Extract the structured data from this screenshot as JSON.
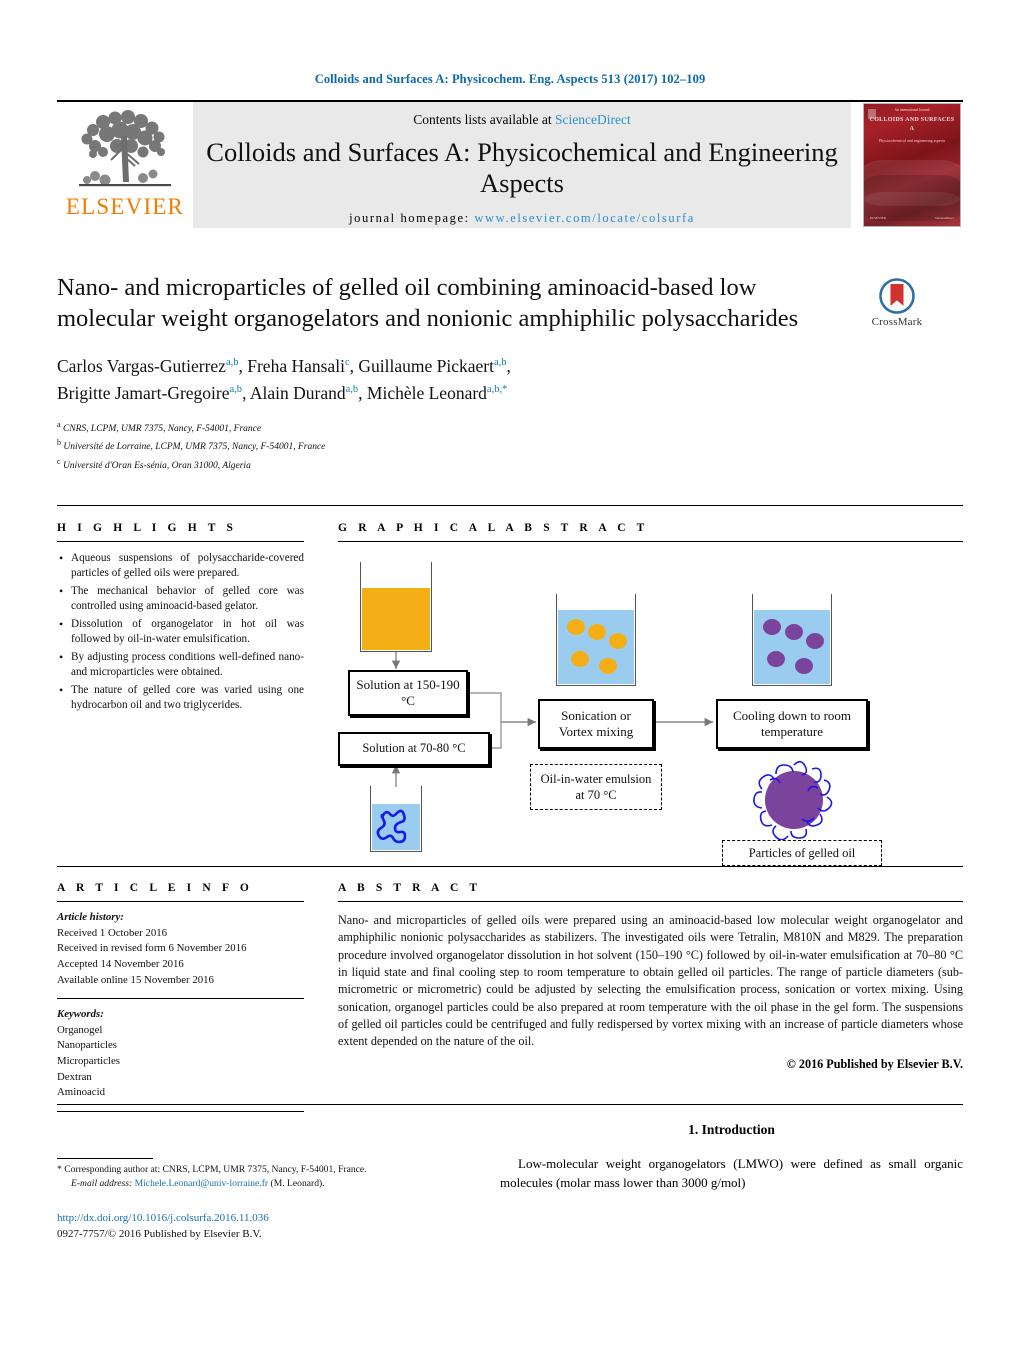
{
  "running_head": "Colloids and Surfaces A: Physicochem. Eng. Aspects 513 (2017) 102–109",
  "masthead": {
    "publisher_word": "ELSEVIER",
    "contents_prefix": "Contents lists available at ",
    "contents_link": "ScienceDirect",
    "journal_title": "Colloids and Surfaces A: Physicochemical and Engineering Aspects",
    "homepage_label": "journal homepage:",
    "homepage_url": "www.elsevier.com/locate/colsurfa",
    "cover": {
      "top_line": "An international Journal",
      "journal_name": "COLLOIDS AND SURFACES A",
      "subtitle": "Physicochemical and engineering aspects",
      "bottom_left": "ELSEVIER",
      "bottom_right": "ScienceDirect"
    }
  },
  "article": {
    "title": "Nano- and microparticles of gelled oil combining aminoacid-based low molecular weight organogelators and nonionic amphiphilic polysaccharides",
    "crossmark_label": "CrossMark",
    "authors": [
      {
        "name": "Carlos Vargas-Gutierrez",
        "marks": "a,b",
        "sep": ", "
      },
      {
        "name": "Freha Hansali",
        "marks": "c",
        "sep": ", "
      },
      {
        "name": "Guillaume Pickaert",
        "marks": "a,b",
        "sep": ", "
      },
      {
        "name": "Brigitte Jamart-Gregoire",
        "marks": "a,b",
        "sep": ", "
      },
      {
        "name": "Alain Durand",
        "marks": "a,b",
        "sep": ", "
      },
      {
        "name": "Michèle Leonard",
        "marks": "a,b,*",
        "sep": ""
      }
    ],
    "affiliations": [
      {
        "mark": "a",
        "text": "CNRS, LCPM, UMR 7375, Nancy, F-54001, France"
      },
      {
        "mark": "b",
        "text": "Université de Lorraine, LCPM, UMR 7375, Nancy, F-54001, France"
      },
      {
        "mark": "c",
        "text": "Université d'Oran Es-sénia, Oran 31000, Algeria"
      }
    ]
  },
  "highlights": {
    "heading": "H I G H L I G H T S",
    "items": [
      "Aqueous suspensions of polysaccharide-covered particles of gelled oils were prepared.",
      "The mechanical behavior of gelled core was controlled using aminoacid-based gelator.",
      "Dissolution of organogelator in hot oil was followed by oil-in-water emulsification.",
      "By adjusting process conditions well-defined nano- and microparticles were obtained.",
      "The nature of gelled core was varied using one hydrocarbon oil and two triglycerides."
    ]
  },
  "graphical_abstract": {
    "heading": "G R A P H I C A L   A B S T R A C T",
    "boxes": {
      "solution_hot": "Solution at 150-190 °C",
      "solution_warm": "Solution at 70-80 °C",
      "sonication": "Sonication or Vortex mixing",
      "cooling": "Cooling down to room temperature",
      "emulsion": "Oil-in-water emulsion at 70 °C",
      "particles": "Particles of gelled oil"
    },
    "colors": {
      "oil": "#F5AF16",
      "water": "#9ACCF0",
      "gelled": "#7B439B",
      "polymer": "#1818E8"
    }
  },
  "article_info": {
    "heading": "A R T I C L E   I N F O",
    "history_label": "Article history:",
    "history": [
      "Received 1 October 2016",
      "Received in revised form 6 November 2016",
      "Accepted 14 November 2016",
      "Available online 15 November 2016"
    ],
    "keywords_label": "Keywords:",
    "keywords": [
      "Organogel",
      "Nanoparticles",
      "Microparticles",
      "Dextran",
      "Aminoacid"
    ]
  },
  "abstract": {
    "heading": "A B S T R A C T",
    "text": "Nano- and microparticles of gelled oils were prepared using an aminoacid-based low molecular weight organogelator and amphiphilic nonionic polysaccharides as stabilizers. The investigated oils were Tetralin, M810N and M829. The preparation procedure involved organogelator dissolution in hot solvent (150–190 °C) followed by oil-in-water emulsification at 70–80 °C in liquid state and final cooling step to room temperature to obtain gelled oil particles. The range of particle diameters (sub-micrometric or micrometric) could be adjusted by selecting the emulsification process, sonication or vortex mixing. Using sonication, organogel particles could be also prepared at room temperature with the oil phase in the gel form. The suspensions of gelled oil particles could be centrifuged and fully redispersed by vortex mixing with an increase of particle diameters whose extent depended on the nature of the oil.",
    "copyright": "© 2016 Published by Elsevier B.V."
  },
  "footer": {
    "corresponding_star": "*",
    "corresponding_text": "Corresponding author at: CNRS, LCPM, UMR 7375, Nancy, F-54001, France.",
    "email_label": "E-mail address:",
    "email": "Michele.Leonard@univ-lorraine.fr",
    "email_owner": "(M. Leonard).",
    "doi": "http://dx.doi.org/10.1016/j.colsurfa.2016.11.036",
    "issn_line": "0927-7757/© 2016 Published by Elsevier B.V."
  },
  "introduction": {
    "heading": "1.  Introduction",
    "paragraph": "Low-molecular weight organogelators (LMWO) were defined as small organic molecules (molar mass lower than 3000 g/mol)"
  }
}
